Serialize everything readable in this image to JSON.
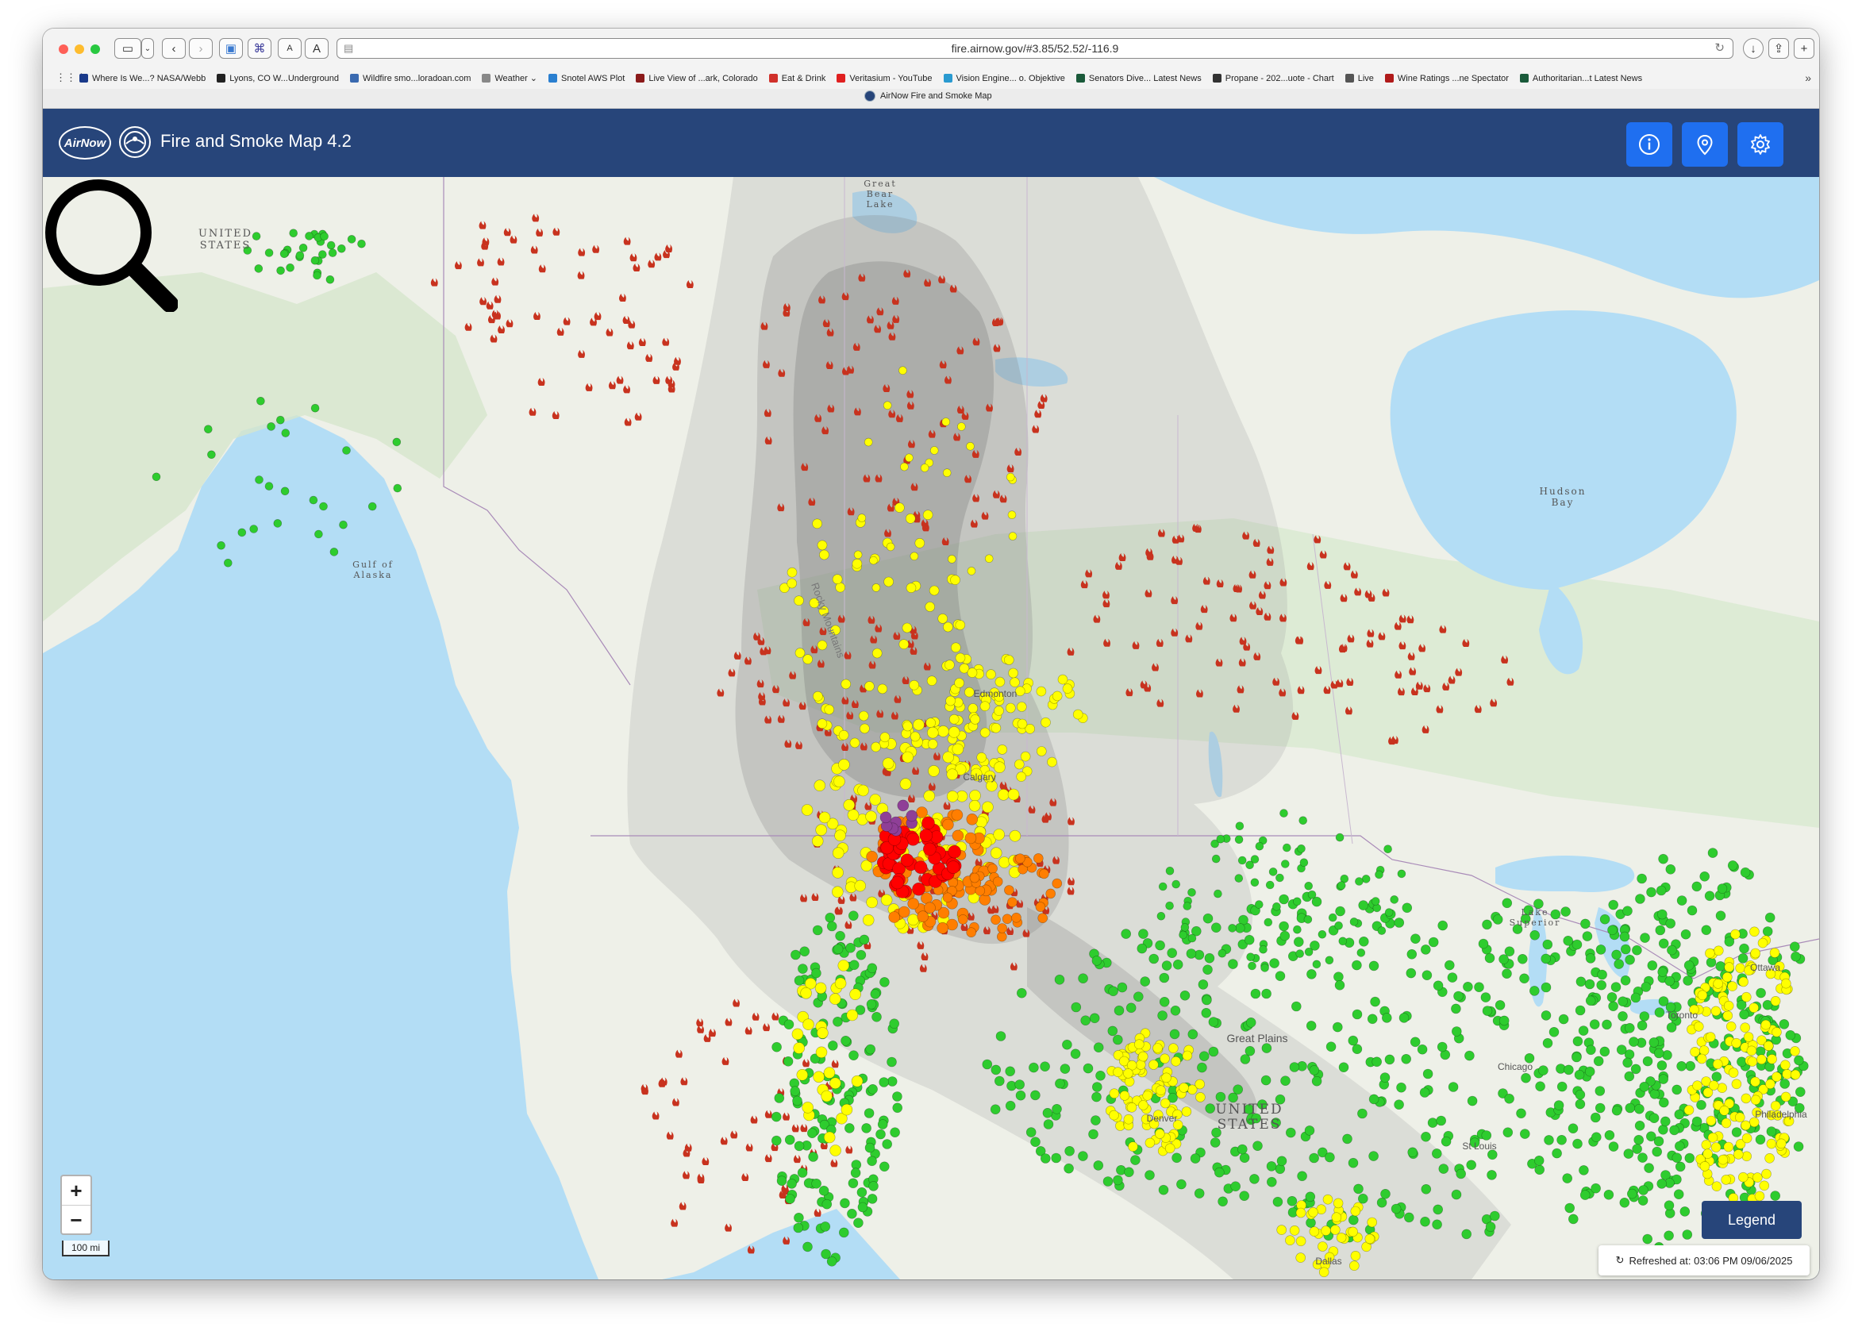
{
  "browser": {
    "url": "fire.airnow.gov/#3.85/52.52/-116.9",
    "text_size_small": "A",
    "text_size_large": "A",
    "bookmarks": [
      {
        "label": "Where Is We...? NASA/Webb",
        "color": "#1a3a8a"
      },
      {
        "label": "Lyons, CO W...Underground",
        "color": "#222222"
      },
      {
        "label": "Wildfire smo...loradoan.com",
        "color": "#3a6ab0"
      },
      {
        "label": "Weather ⌄",
        "color": "#888888"
      },
      {
        "label": "Snotel AWS Plot",
        "color": "#2a7fd0"
      },
      {
        "label": "Live View of ...ark, Colorado",
        "color": "#8b1a1a"
      },
      {
        "label": "Eat & Drink",
        "color": "#d0302a"
      },
      {
        "label": "Veritasium - YouTube",
        "color": "#e02020"
      },
      {
        "label": "Vision Engine... o. Objektive",
        "color": "#2a9ad0"
      },
      {
        "label": "Senators Dive... Latest News",
        "color": "#1a5a3a"
      },
      {
        "label": "Propane - 202...uote - Chart",
        "color": "#333333"
      },
      {
        "label": "Live",
        "color": "#555555"
      },
      {
        "label": "Wine Ratings ...ne Spectator",
        "color": "#b01a1a"
      },
      {
        "label": "Authoritarian...t Latest News",
        "color": "#1a5a3a"
      }
    ],
    "active_tab": "AirNow Fire and Smoke Map"
  },
  "app": {
    "logo_text": "AirNow",
    "title": "Fire and Smoke Map 4.2",
    "buttons": {
      "info": "info-icon",
      "location": "location-pin-icon",
      "settings": "gear-icon"
    },
    "brand_color": "#27457a",
    "button_color": "#1f6ff0"
  },
  "map": {
    "labels": {
      "alaska_us": "UNITED\nSTATES",
      "great_bear_lake": "Great\nBear\nLake",
      "hudson_bay": "Hudson\nBay",
      "gulf_of_alaska": "Gulf of\nAlaska",
      "rocky_mountains": "Rocky Mountains",
      "edmonton": "Edmonton",
      "calgary": "Calgary",
      "lake_superior": "Lake\nSuperior",
      "great_plains": "Great Plains",
      "united_states": "UNITED\nSTATES",
      "chicago": "Chicago",
      "st_louis": "St Louis",
      "toronto": "Toronto",
      "ottawa": "Ottawa",
      "denver": "Denver",
      "philadelphia": "Philadelphia",
      "dallas": "Dallas"
    },
    "aqi_colors": {
      "good": "#2ecc2e",
      "moderate": "#ffff00",
      "usg": "#ff7e00",
      "unhealthy": "#ff0000",
      "very_unhealthy": "#8f3f97"
    },
    "zoom_in": "+",
    "zoom_out": "−",
    "scale": "100 mi",
    "legend_button": "Legend",
    "refreshed": "Refreshed at: 03:06 PM 09/06/2025",
    "attribution": "i"
  }
}
